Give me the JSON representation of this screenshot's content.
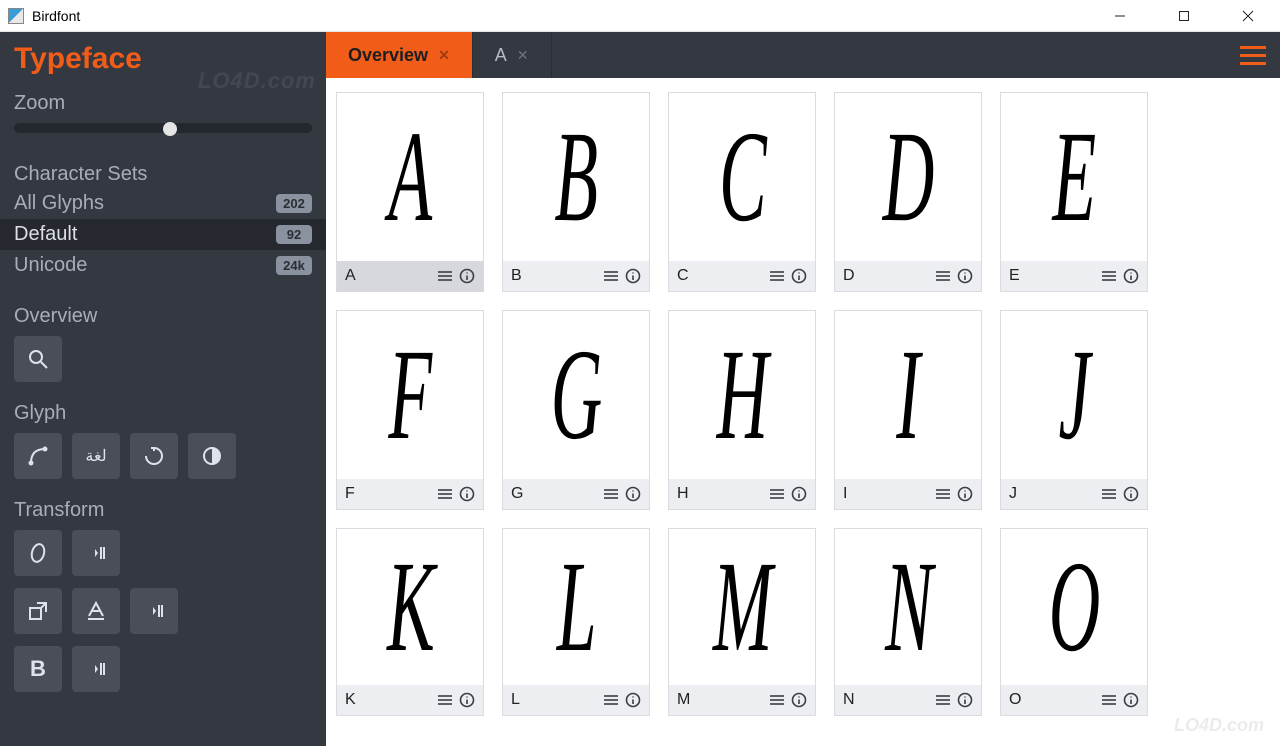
{
  "window": {
    "title": "Birdfont"
  },
  "sidebar": {
    "header": "Typeface",
    "zoom_label": "Zoom",
    "charset_label": "Character Sets",
    "charsets": [
      {
        "label": "All Glyphs",
        "count": "202"
      },
      {
        "label": "Default",
        "count": "92"
      },
      {
        "label": "Unicode",
        "count": "24k"
      }
    ],
    "overview_label": "Overview",
    "glyph_label": "Glyph",
    "glyph_lang_btn": "لغة",
    "transform_label": "Transform"
  },
  "tabs": {
    "items": [
      {
        "label": "Overview"
      },
      {
        "label": "A"
      }
    ]
  },
  "glyphs": [
    {
      "big": "A",
      "label": "A"
    },
    {
      "big": "B",
      "label": "B"
    },
    {
      "big": "C",
      "label": "C"
    },
    {
      "big": "D",
      "label": "D"
    },
    {
      "big": "E",
      "label": "E"
    },
    {
      "big": "F",
      "label": "F"
    },
    {
      "big": "G",
      "label": "G"
    },
    {
      "big": "H",
      "label": "H"
    },
    {
      "big": "I",
      "label": "I"
    },
    {
      "big": "J",
      "label": "J"
    },
    {
      "big": "K",
      "label": "K"
    },
    {
      "big": "L",
      "label": "L"
    },
    {
      "big": "M",
      "label": "M"
    },
    {
      "big": "N",
      "label": "N"
    },
    {
      "big": "O",
      "label": "O"
    }
  ],
  "watermarks": {
    "top": "LO4D.com",
    "bottom": "LO4D.com"
  }
}
